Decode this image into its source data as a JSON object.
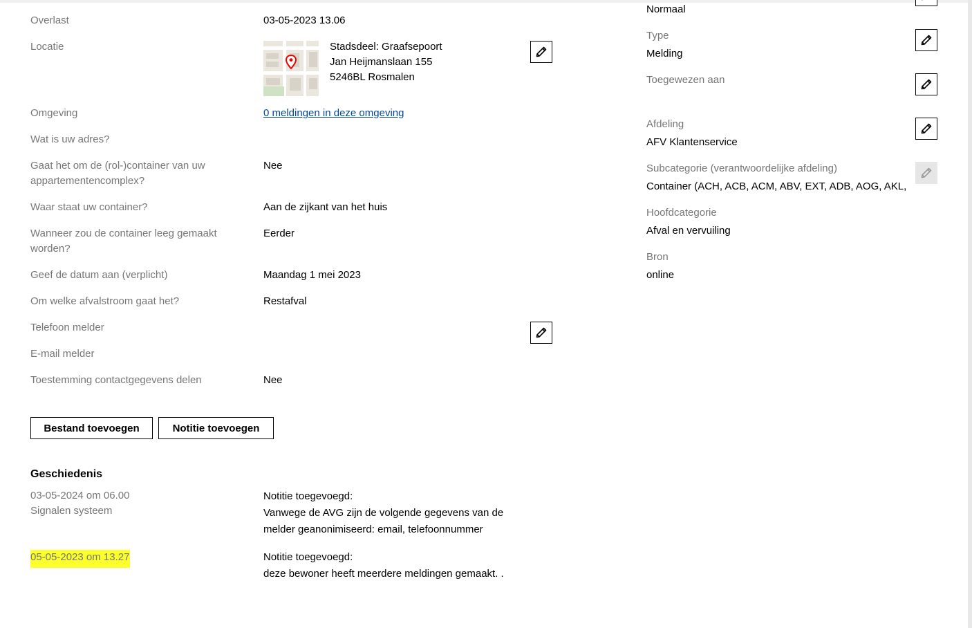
{
  "left_fields": [
    {
      "label": "Overlast",
      "value": "03-05-2023 13.06"
    },
    {
      "label": "Locatie",
      "address_lines": [
        "Stadsdeel: Graafsepoort",
        "Jan Heijmanslaan 155",
        "5246BL Rosmalen"
      ]
    },
    {
      "label": "Omgeving",
      "link": "0 meldingen in deze omgeving"
    },
    {
      "label": "Wat is uw adres?",
      "value": ""
    },
    {
      "label_lines": [
        "Gaat het om de (rol-)container van uw",
        "appartementencomplex?"
      ],
      "value": "Nee"
    },
    {
      "label": "Waar staat uw container?",
      "value": "Aan de zijkant van het huis"
    },
    {
      "label_lines": [
        "Wanneer zou de container leeg gemaakt",
        "worden?"
      ],
      "value": "Eerder"
    },
    {
      "label": "Geef de datum aan (verplicht)",
      "value": "Maandag 1 mei 2023"
    },
    {
      "label": "Om welke afvalstroom gaat het?",
      "value": "Restafval"
    },
    {
      "label": "Telefoon melder",
      "value": ""
    },
    {
      "label": "E-mail melder",
      "value": ""
    },
    {
      "label": "Toestemming contactgegevens delen",
      "value": "Nee"
    }
  ],
  "right_fields": [
    {
      "label": "",
      "value": "Normaal"
    },
    {
      "label": "Type",
      "value": "Melding"
    },
    {
      "label": "Toegewezen aan",
      "value": ""
    },
    {
      "label": "Afdeling",
      "value": "AFV Klantenservice"
    },
    {
      "label": "Subcategorie (verantwoordelijke afdeling)",
      "value": "Container (ACH, ACB, ACM, ABV, EXT, ADB, AOG, AKL,"
    },
    {
      "label": "Hoofdcategorie",
      "value": "Afval en vervuiling"
    },
    {
      "label": "Bron",
      "value": "online"
    }
  ],
  "buttons": {
    "add_file": "Bestand toevoegen",
    "add_note": "Notitie toevoegen"
  },
  "history": {
    "title": "Geschiedenis",
    "entries": [
      {
        "date": "03-05-2024 om 06.00",
        "who": "Signalen systeem",
        "lines": [
          "Notitie toegevoegd:",
          "Vanwege de AVG zijn de volgende gegevens van de",
          "melder geanonimiseerd: email, telefoonnummer"
        ]
      },
      {
        "date": "05-05-2023 om 13.27",
        "who": "",
        "lines": [
          "Notitie toegevoegd:",
          "deze bewoner heeft meerdere meldingen gemaakt. ."
        ]
      }
    ]
  },
  "icons": {
    "edit": "pencil-icon",
    "map_marker": "map-pin-icon"
  },
  "colors": {
    "label": "#767676",
    "link": "#004699",
    "highlight": "#fbff2c",
    "pin": "#ec0000"
  }
}
